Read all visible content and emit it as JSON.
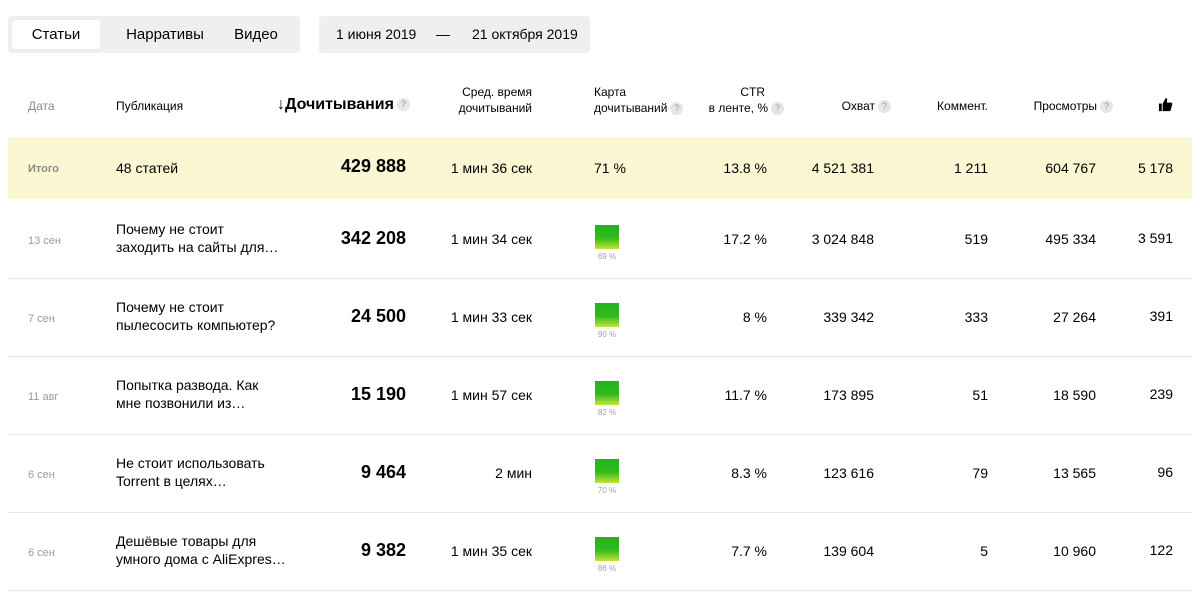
{
  "tabs": [
    {
      "label": "Статьи",
      "active": true
    },
    {
      "label": "Нарративы",
      "active": false
    },
    {
      "label": "Видео",
      "active": false
    }
  ],
  "date_range": {
    "from": "1 июня 2019",
    "sep": "—",
    "to": "21 октября 2019"
  },
  "columns": {
    "date": "Дата",
    "publication": "Публикация",
    "reads": "Дочитывания",
    "sort_arrow": "↓",
    "avg_time_1": "Сред. время",
    "avg_time_2": "дочитываний",
    "map_1": "Карта",
    "map_2": "дочитываний",
    "ctr_1": "CTR",
    "ctr_2": "в ленте, %",
    "reach": "Охват",
    "comments": "Коммент.",
    "views": "Просмотры",
    "likes_icon": "thumbs-up-icon",
    "help": "?"
  },
  "total": {
    "label": "Итого",
    "publication": "48 статей",
    "reads": "429 888",
    "avg_time": "1 мин 36 сек",
    "map": "71 %",
    "ctr": "13.8 %",
    "reach": "4 521 381",
    "comments": "1 211",
    "views": "604 767",
    "likes": "5 178"
  },
  "rows": [
    {
      "date": "13 сен",
      "title_1": "Почему не стоит",
      "title_2": "заходить на сайты для…",
      "reads": "342 208",
      "avg_time": "1 мин 34 сек",
      "map_pct": "69 %",
      "map_value": 69,
      "ctr": "17.2 %",
      "reach": "3 024 848",
      "comments": "519",
      "views": "495 334",
      "likes": "3 591"
    },
    {
      "date": "7 сен",
      "title_1": "Почему не стоит",
      "title_2": "пылесосить компьютер?",
      "reads": "24 500",
      "avg_time": "1 мин 33 сек",
      "map_pct": "90 %",
      "map_value": 90,
      "ctr": "8 %",
      "reach": "339 342",
      "comments": "333",
      "views": "27 264",
      "likes": "391"
    },
    {
      "date": "11 авг",
      "title_1": "Попытка развода. Как",
      "title_2": "мне позвонили из…",
      "reads": "15 190",
      "avg_time": "1 мин 57 сек",
      "map_pct": "82 %",
      "map_value": 82,
      "ctr": "11.7 %",
      "reach": "173 895",
      "comments": "51",
      "views": "18 590",
      "likes": "239"
    },
    {
      "date": "6 сен",
      "title_1": "Не стоит использовать",
      "title_2": "Torrent в целях…",
      "reads": "9 464",
      "avg_time": "2 мин",
      "map_pct": "70 %",
      "map_value": 70,
      "ctr": "8.3 %",
      "reach": "123 616",
      "comments": "79",
      "views": "13 565",
      "likes": "96"
    },
    {
      "date": "6 сен",
      "title_1": "Дешёвые товары для",
      "title_2": "умного дома с AliExpres…",
      "reads": "9 382",
      "avg_time": "1 мин 35 сек",
      "map_pct": "86 %",
      "map_value": 86,
      "ctr": "7.7 %",
      "reach": "139 604",
      "comments": "5",
      "views": "10 960",
      "likes": "122"
    }
  ],
  "colors": {
    "total_bg": "#fbf7d3",
    "bar_top": "#23b223",
    "bar_bottom": "#c6e23a"
  }
}
